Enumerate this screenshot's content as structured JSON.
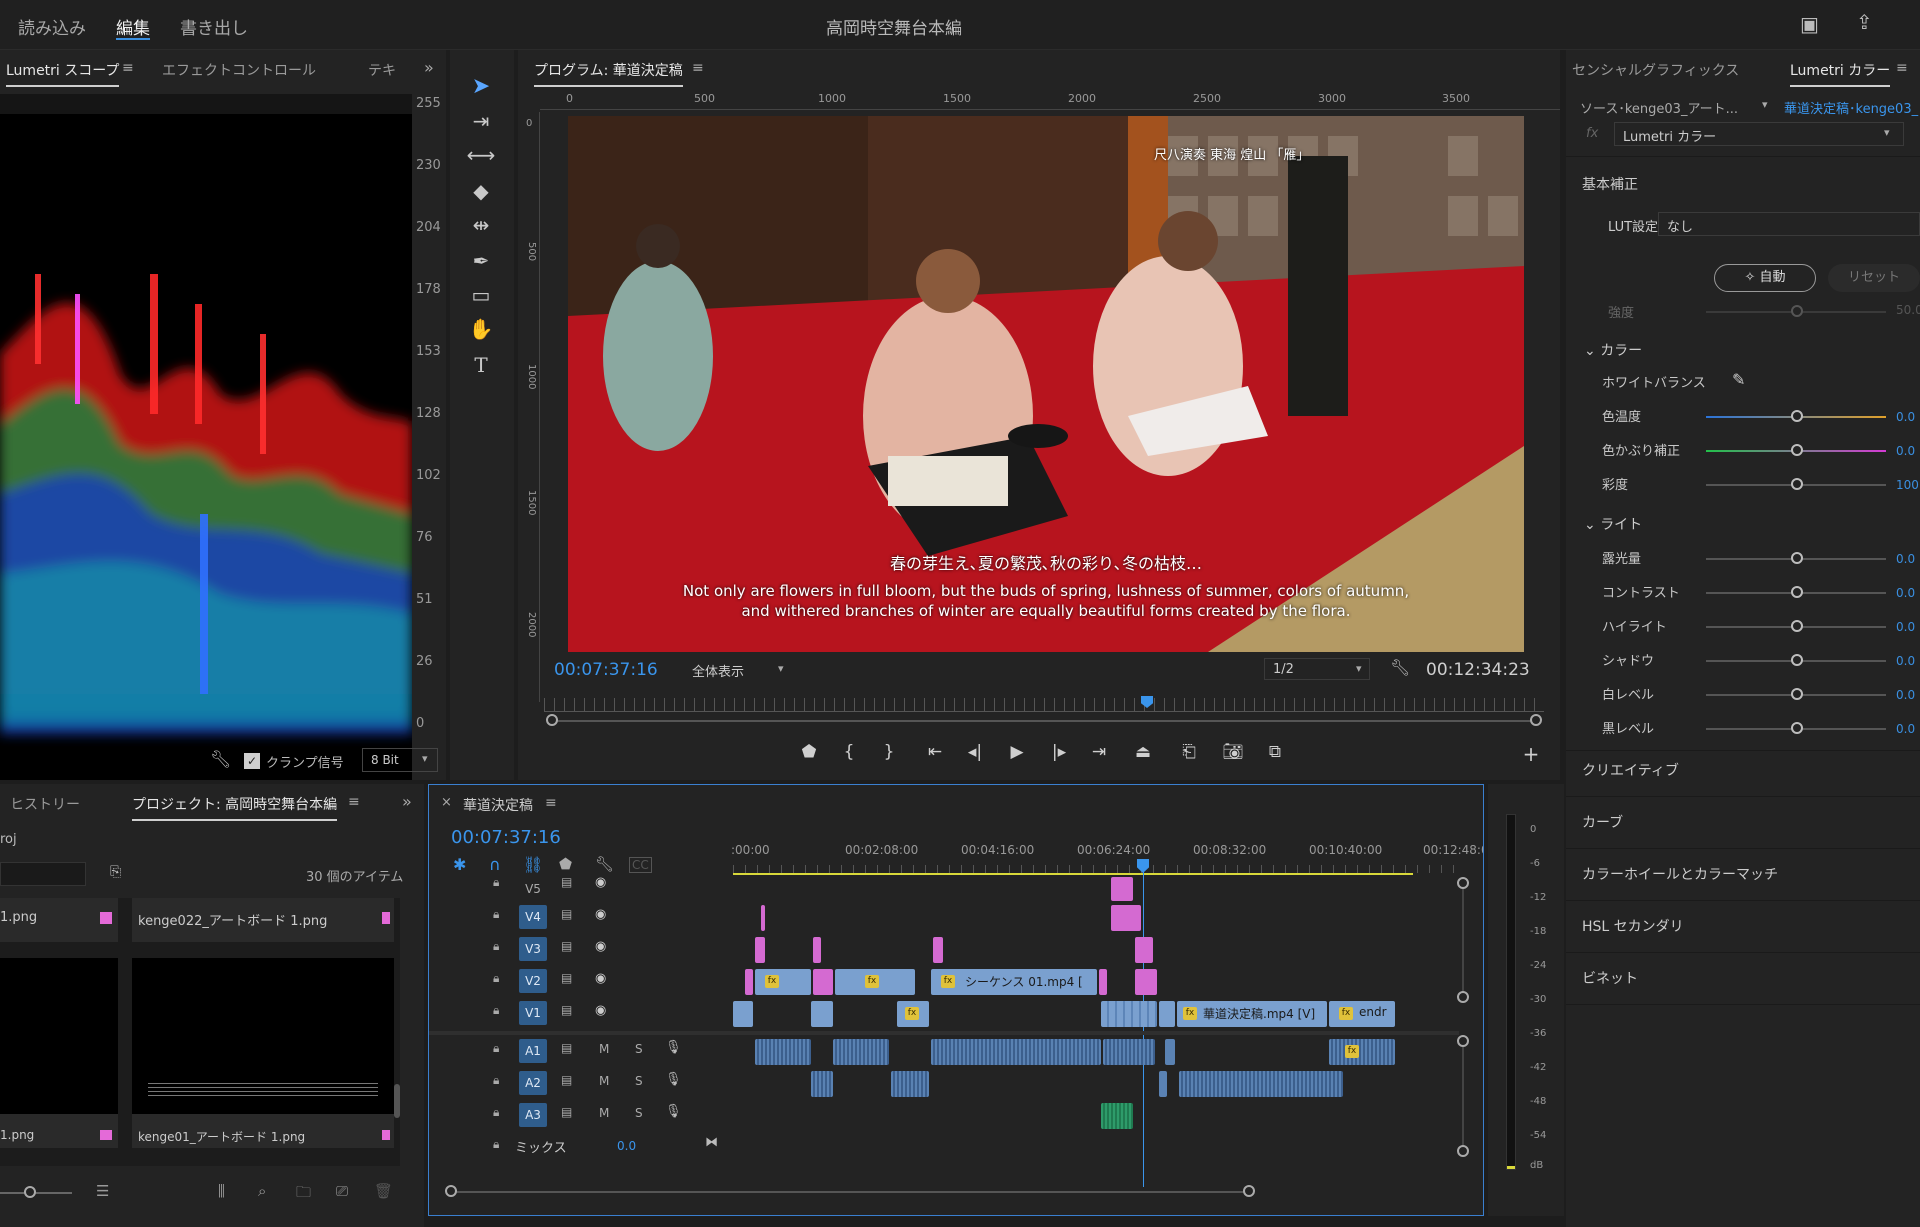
{
  "app": {
    "title": "高岡時空舞台本編",
    "menu": [
      "読み込み",
      "編集",
      "書き出し"
    ],
    "active_menu": "編集"
  },
  "scopes": {
    "tabs": [
      "Lumetri スコープ",
      "エフェクトコントロール",
      "テキ"
    ],
    "scale": [
      "255",
      "230",
      "204",
      "178",
      "153",
      "128",
      "102",
      "76",
      "51",
      "26",
      "0"
    ],
    "clamp_label": "クランプ信号",
    "bit_depth": "8 Bit"
  },
  "program": {
    "title": "プログラム: 華道決定稿",
    "ruler": [
      "0",
      "500",
      "1000",
      "1500",
      "2000",
      "2500",
      "3000",
      "3500"
    ],
    "vruler": [
      "0",
      "500",
      "1000",
      "1500",
      "2000"
    ],
    "timecode": "00:07:37:16",
    "zoom": "全体表示",
    "resolution": "1/2",
    "duration": "00:12:34:23",
    "overlay_credit": "尺八演奏 東海 煌山 「雁」",
    "subtitle_jp": "春の芽生え､夏の繁茂､秋の彩り､冬の枯枝…",
    "subtitle_en1": "Not only are flowers in full bloom, but the buds of spring, lushness of summer, colors of autumn,",
    "subtitle_en2": "and withered branches of winter are equally beautiful forms created by the flora."
  },
  "essentials": {
    "tabs": [
      "センシャルグラフィックス",
      "Lumetri カラー"
    ],
    "source": "ソース･kenge03_アート...",
    "target": "華道決定稿･kenge03_",
    "effect": "Lumetri カラー",
    "basic": "基本補正",
    "lut_label": "LUT設定",
    "lut_value": "なし",
    "auto_btn": "自動",
    "reset_btn": "リセット",
    "intensity": "強度",
    "intensity_val": "50.0",
    "color_section": "カラー",
    "white_balance": "ホワイトバランス",
    "sliders": [
      {
        "label": "色温度",
        "value": "0.0"
      },
      {
        "label": "色かぶり補正",
        "value": "0.0"
      },
      {
        "label": "彩度",
        "value": "100."
      }
    ],
    "light_section": "ライト",
    "light_sliders": [
      {
        "label": "露光量",
        "value": "0.0"
      },
      {
        "label": "コントラスト",
        "value": "0.0"
      },
      {
        "label": "ハイライト",
        "value": "0.0"
      },
      {
        "label": "シャドウ",
        "value": "0.0"
      },
      {
        "label": "白レベル",
        "value": "0.0"
      },
      {
        "label": "黒レベル",
        "value": "0.0"
      }
    ],
    "sections": [
      "クリエイティブ",
      "カーブ",
      "カラーホイールとカラーマッチ",
      "HSL セカンダリ",
      "ビネット"
    ]
  },
  "project": {
    "tabs": [
      "ヒストリー",
      "プロジェクト: 高岡時空舞台本編"
    ],
    "path": "roj",
    "count": "30 個のアイテム",
    "items": [
      {
        "name": "1.png"
      },
      {
        "name": "kenge022_アートボード 1.png"
      },
      {
        "name": "1.png"
      },
      {
        "name": "kenge01_アートボード 1.png"
      }
    ]
  },
  "timeline": {
    "title": "華道決定稿",
    "timecode": "00:07:37:16",
    "ruler": [
      ":00:00",
      "00:02:08:00",
      "00:04:16:00",
      "00:06:24:00",
      "00:08:32:00",
      "00:10:40:00",
      "00:12:48:0"
    ],
    "video_tracks": [
      "V5",
      "V4",
      "V3",
      "V2",
      "V1"
    ],
    "audio_tracks": [
      "A1",
      "A2",
      "A3"
    ],
    "mix_label": "ミックス",
    "mix_value": "0.0",
    "clip_labels": {
      "v2": "シーケンス 01.mp4 [",
      "v1": "華道決定稿.mp4 [V]",
      "v1end": "endr"
    },
    "m": "M",
    "s": "S"
  },
  "meter": {
    "scale": [
      "0",
      "-6",
      "-12",
      "-18",
      "-24",
      "-30",
      "-36",
      "-42",
      "-48",
      "-54",
      "dB"
    ]
  }
}
